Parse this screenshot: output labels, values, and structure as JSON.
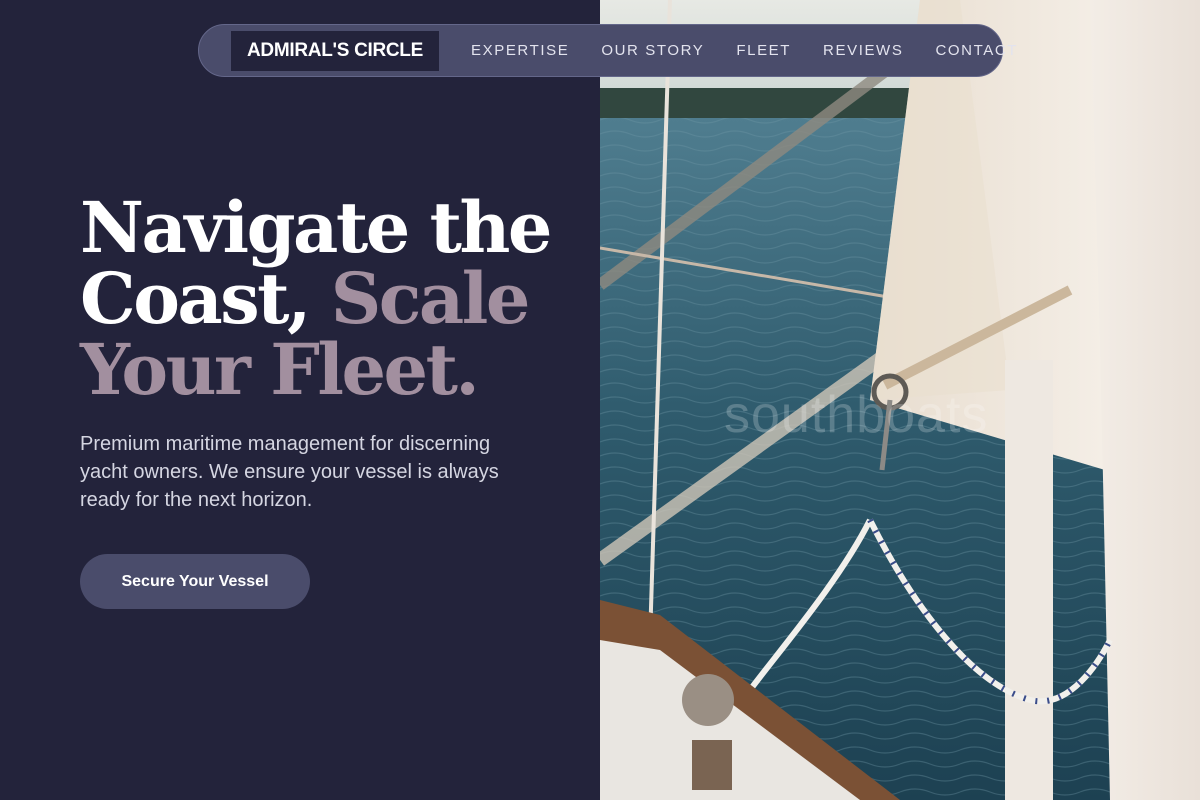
{
  "nav": {
    "brand": "ADMIRAL'S CIRCLE",
    "links": [
      "EXPERTISE",
      "OUR STORY",
      "FLEET",
      "REVIEWS",
      "CONTACT"
    ]
  },
  "hero": {
    "headline_white_1": "Navigate the",
    "headline_white_2": "Coast, ",
    "headline_accent_1": "Scale",
    "headline_accent_2": "Your Fleet.",
    "lead": "Premium maritime management for discerning yacht owners. We ensure your vessel is always ready for the next horizon.",
    "cta_label": "Secure Your Vessel"
  },
  "image": {
    "watermark": "southboats",
    "subject": "sailboat-rigging-over-water"
  },
  "colors": {
    "background": "#23233b",
    "nav_pill": "#4a4c6b",
    "accent_text": "#a28f9f",
    "water": "#2f5a6b"
  }
}
